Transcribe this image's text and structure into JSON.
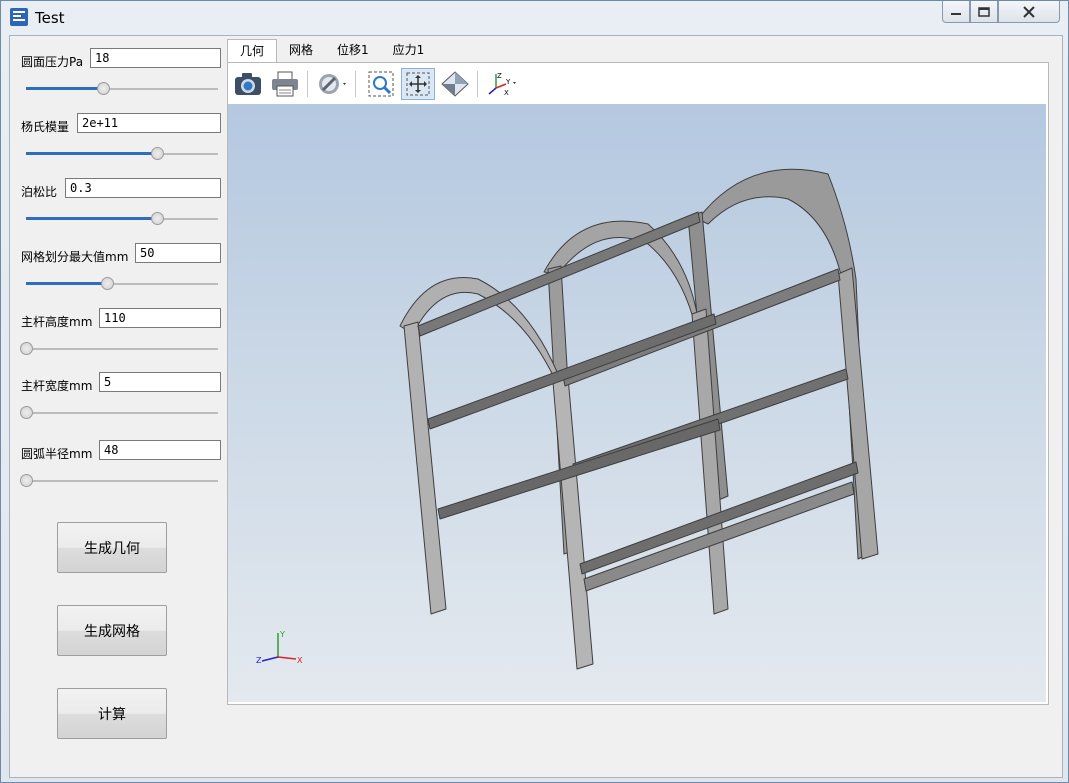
{
  "window": {
    "title": "Test"
  },
  "params": [
    {
      "label": "圆面压力Pa",
      "value": "18",
      "slider": 0.4
    },
    {
      "label": "杨氏模量",
      "value": "2e+11",
      "slider": 0.68
    },
    {
      "label": "泊松比",
      "value": "0.3",
      "slider": 0.68
    },
    {
      "label": "网格划分最大值mm",
      "value": "50",
      "slider": 0.42
    },
    {
      "label": "主杆高度mm",
      "value": "110",
      "slider": 0.0
    },
    {
      "label": "主杆宽度mm",
      "value": "5",
      "slider": 0.0
    },
    {
      "label": "圆弧半径mm",
      "value": "48",
      "slider": 0.0
    }
  ],
  "buttons": {
    "geometry": "生成几何",
    "mesh": "生成网格",
    "compute": "计算"
  },
  "tabs": [
    "几何",
    "网格",
    "位移1",
    "应力1"
  ],
  "active_tab": "几何",
  "toolbar_icons": [
    "camera-icon",
    "print-icon",
    "display-mode-icon",
    "zoom-box-icon",
    "fit-all-icon",
    "view-cube-icon",
    "axis-view-icon"
  ],
  "axes": {
    "x": "X",
    "y": "Y",
    "z": "Z"
  },
  "colors": {
    "accent": "#2e6fbd",
    "model": "#a9a9a9"
  }
}
